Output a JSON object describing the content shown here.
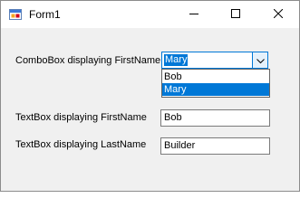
{
  "window": {
    "title": "Form1"
  },
  "icons": {
    "app": "winforms-app-icon",
    "minimize": "minimize-icon",
    "maximize": "maximize-icon",
    "close": "close-icon",
    "dropdown_arrow": "chevron-down-icon"
  },
  "form": {
    "combo_label": "ComboBox displaying FirstName",
    "combo_value": "Mary",
    "combo_options": [
      "Bob",
      "Mary"
    ],
    "combo_highlighted_option": "Mary",
    "firstname_label": "TextBox displaying FirstName",
    "firstname_value": "Bob",
    "lastname_label": "TextBox displaying LastName",
    "lastname_value": "Builder"
  },
  "colors": {
    "accent": "#0078d7",
    "window_bg": "#f0f0f0",
    "titlebar_bg": "#ffffff"
  }
}
